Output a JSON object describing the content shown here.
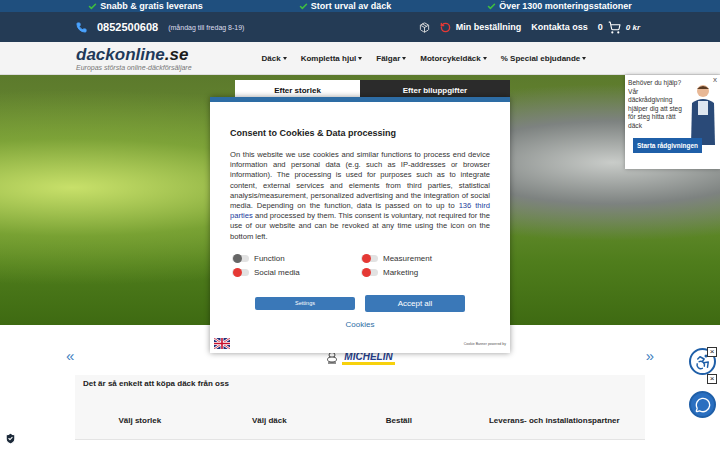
{
  "top_strip": [
    "Snabb & gratis leverans",
    "Stort urval av däck",
    "Över 1300 monteringsstationer"
  ],
  "contact": {
    "phone": "0852500608",
    "hours": "(måndag till fredag 8-19)"
  },
  "account_links": [
    "Min beställning",
    "Kontakta oss"
  ],
  "cart": {
    "count": "0",
    "total": "0 kr"
  },
  "logo": {
    "name": "dackonline",
    "tld": ".se",
    "tagline": "Europas största online-däckförsäljare"
  },
  "nav": [
    "Däck",
    "Kompletta hjul",
    "Fälgar",
    "Motorcykeldäck",
    "% Special ebjudande"
  ],
  "search_tabs": [
    {
      "label": "Efter storlek",
      "selected": true
    },
    {
      "label": "Efter biluppgifter",
      "selected": false
    }
  ],
  "cookie_dialog": {
    "title": "Consent to Cookies & Data processing",
    "text_before": "On this website we use cookies and similar functions to process end device information and personal data (e.g. such as IP-addresses or browser information). The processing is used for purposes such as to integrate content, external services and elements from third parties, statistical analysis/measurement, personalized advertising and the integration of social media. Depending on the function, data is passed on to up to ",
    "link": "136 third parties",
    "text_after": " and processed by them. This consent is voluntary, not required for the use of our website and can be revoked at any time using the icon on the bottom left.",
    "toggles": [
      {
        "label": "Function",
        "on": false,
        "disabled": true
      },
      {
        "label": "Measurement",
        "on": false,
        "disabled": false
      },
      {
        "label": "Social media",
        "on": false,
        "disabled": false
      },
      {
        "label": "Marketing",
        "on": false,
        "disabled": false
      }
    ],
    "buttons": [
      {
        "label": "Settings",
        "kind": "secondary"
      },
      {
        "label": "Accept all",
        "kind": "primary"
      }
    ],
    "cookies_link": "Cookies",
    "footer": "Cookie Banner powered by"
  },
  "help_popup": {
    "close": "x",
    "text": "Behöver du hjälp? Vår däckrådgivning hjälper dig att steg för steg hitta rätt däck",
    "button": "Starta rådgivningen"
  },
  "carousel": {
    "prev": "«",
    "next": "»",
    "brand": "MICHELIN"
  },
  "how_to": {
    "title": "Det är så enkelt att köpa däck från oss",
    "steps": [
      "Välj storlek",
      "Välj däck",
      "Beställ",
      "Leverans- och installationspartner"
    ]
  },
  "floating_closes": [
    "×",
    "×"
  ]
}
